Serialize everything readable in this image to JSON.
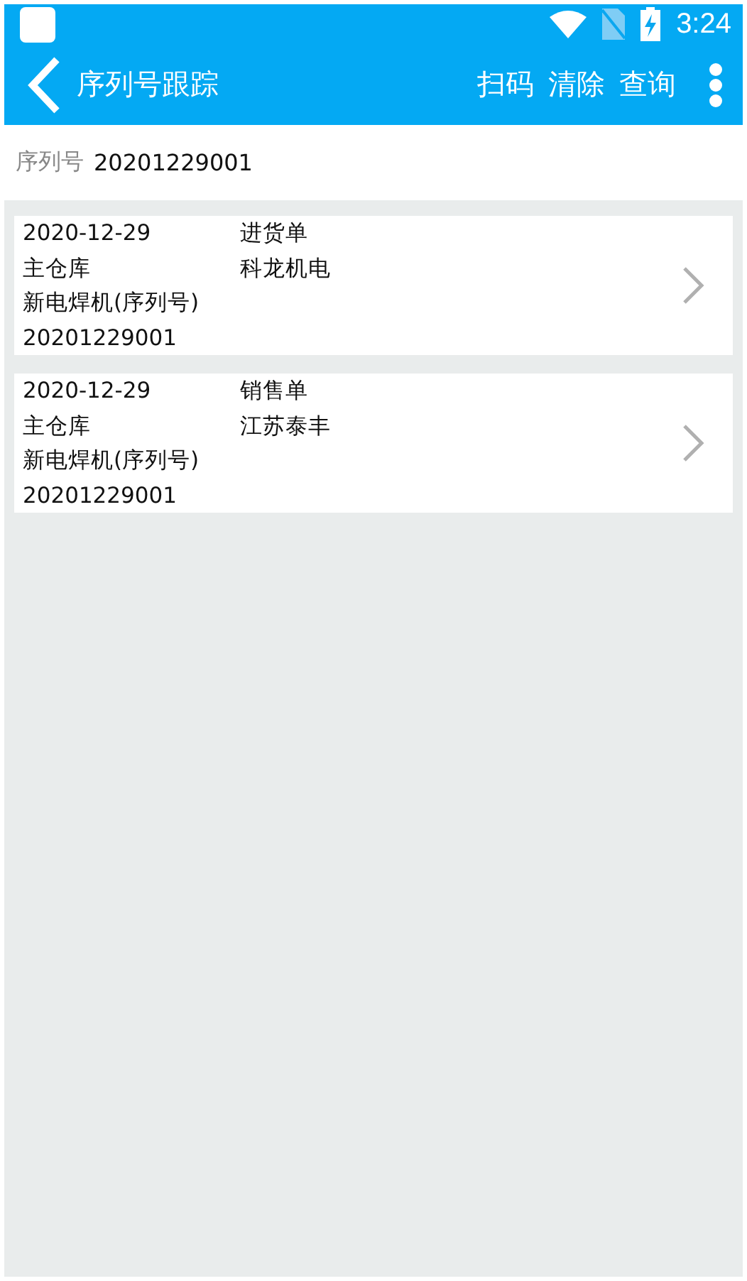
{
  "status_bar": {
    "time": "3:24"
  },
  "app_bar": {
    "title": "序列号跟踪",
    "actions": [
      "扫码",
      "清除",
      "查询"
    ]
  },
  "search": {
    "label": "序列号",
    "value": "20201229001"
  },
  "records": [
    {
      "date": "2020-12-29",
      "doc_type": "进货单",
      "warehouse": "主仓库",
      "partner": "科龙机电",
      "product": "新电焊机(序列号)",
      "serial": "20201229001"
    },
    {
      "date": "2020-12-29",
      "doc_type": "销售单",
      "warehouse": "主仓库",
      "partner": "江苏泰丰",
      "product": "新电焊机(序列号)",
      "serial": "20201229001"
    }
  ]
}
